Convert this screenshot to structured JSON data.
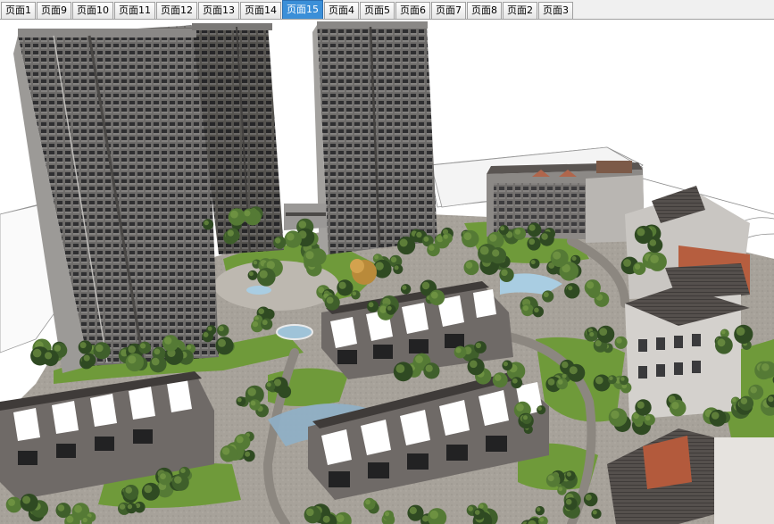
{
  "tabs": [
    {
      "label": "页面1",
      "active": false
    },
    {
      "label": "页面9",
      "active": false
    },
    {
      "label": "页面10",
      "active": false
    },
    {
      "label": "页面11",
      "active": false
    },
    {
      "label": "页面12",
      "active": false
    },
    {
      "label": "页面13",
      "active": false
    },
    {
      "label": "页面14",
      "active": false
    },
    {
      "label": "页面15",
      "active": true
    },
    {
      "label": "页面4",
      "active": false
    },
    {
      "label": "页面5",
      "active": false
    },
    {
      "label": "页面6",
      "active": false
    },
    {
      "label": "页面7",
      "active": false
    },
    {
      "label": "页面8",
      "active": false
    },
    {
      "label": "页面2",
      "active": false
    },
    {
      "label": "页面3",
      "active": false
    }
  ],
  "colors": {
    "active_tab": "#3b8fd8",
    "tab_bg": "#efefef",
    "sky": "#ffffff",
    "ground": "#a9a39b",
    "grass": "#6f9a3a",
    "tower": "#6c6a68",
    "roof": "#4a4644",
    "brick": "#b05a3c"
  }
}
